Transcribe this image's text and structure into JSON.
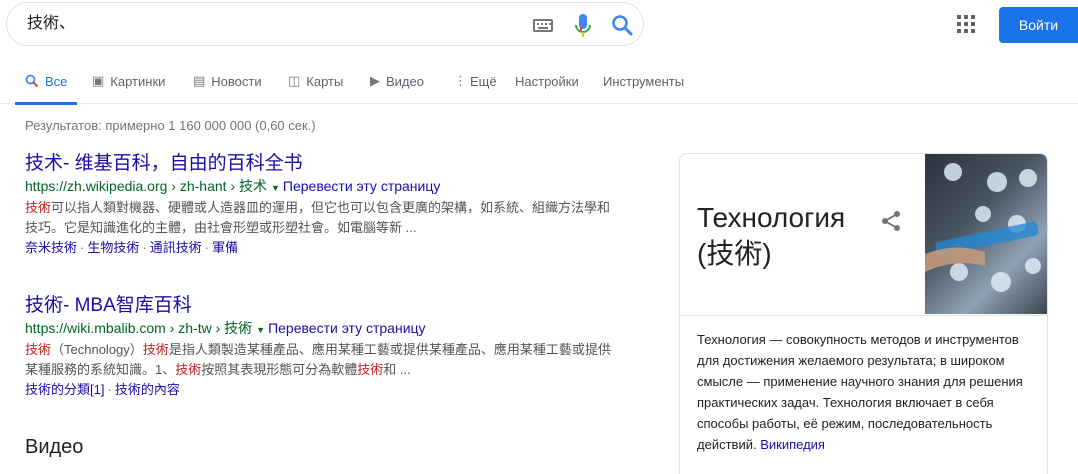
{
  "search": {
    "query": "技術、"
  },
  "header": {
    "signin_label": "Войти"
  },
  "tabs": [
    {
      "label": "Все",
      "icon": "search-icon"
    },
    {
      "label": "Картинки",
      "icon": "image-icon"
    },
    {
      "label": "Новости",
      "icon": "news-icon"
    },
    {
      "label": "Карты",
      "icon": "map-icon"
    },
    {
      "label": "Видео",
      "icon": "video-icon"
    },
    {
      "label": "Ещё",
      "icon": "more-vert-icon"
    },
    {
      "label": "Настройки"
    },
    {
      "label": "Инструменты"
    }
  ],
  "stats": "Результатов: примерно 1 160 000 000 (0,60 сек.)",
  "results": [
    {
      "title": "技术- 维基百科，自由的百科全书",
      "url": "https://zh.wikipedia.org › zh-hant › 技术",
      "translate": "Перевести эту страницу",
      "snippet_hl": "技術",
      "snippet_rest": "可以指人類對機器、硬體或人造器皿的運用，但它也可以包含更廣的架構，如系統、組織方法學和技巧。它是知識進化的主體，由社會形塑或形塑社會。如電腦等新 ...",
      "links": [
        "奈米技術",
        "生物技術",
        "通訊技術",
        "軍備"
      ]
    },
    {
      "title": "技術- MBA智库百科",
      "url": "https://wiki.mbalib.com › zh-tw › 技術",
      "translate": "Перевести эту страницу",
      "snippet_parts": [
        "技術",
        "（Technology）",
        "技術",
        "是指人類製造某種產品、應用某種工藝或提供某種產品、應用某種工藝或提供某種服務的系統知識。1、",
        "技術",
        "按照其表現形態可分為軟體",
        "技術",
        "和 ..."
      ],
      "links": [
        "技術的分類[1]",
        "技術的內容"
      ]
    }
  ],
  "video_heading": "Видео",
  "knowledge_panel": {
    "title": "Технология (技術)",
    "description": "Технология — совокупность методов и инструментов для достижения желаемого результата; в широком смысле — применение научного знания для решения практических задач. Технология включает в себя способы работы, её режим, последовательность действий.",
    "source": "Википедия"
  },
  "colors": {
    "accent": "#1a73e8",
    "link": "#1a0dab",
    "url_green": "#006621",
    "highlight_red": "#c5221f"
  }
}
